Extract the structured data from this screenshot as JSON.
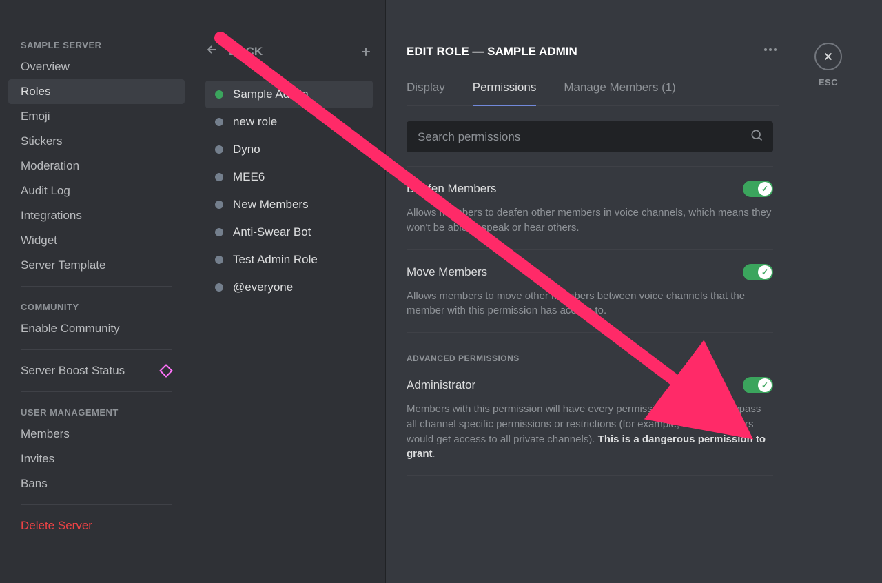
{
  "sidebar": {
    "server_name": "SAMPLE SERVER",
    "sections": {
      "main": [
        "Overview",
        "Roles",
        "Emoji",
        "Stickers",
        "Moderation",
        "Audit Log",
        "Integrations",
        "Widget",
        "Server Template"
      ],
      "community_header": "COMMUNITY",
      "community": [
        "Enable Community"
      ],
      "boost": "Server Boost Status",
      "user_header": "USER MANAGEMENT",
      "user": [
        "Members",
        "Invites",
        "Bans"
      ],
      "danger": "Delete Server"
    },
    "active_item": "Roles"
  },
  "rolecol": {
    "back_label": "BACK",
    "roles": [
      {
        "name": "Sample Admin",
        "color": "green",
        "selected": true
      },
      {
        "name": "new role",
        "color": "grey",
        "selected": false
      },
      {
        "name": "Dyno",
        "color": "grey",
        "selected": false
      },
      {
        "name": "MEE6",
        "color": "grey",
        "selected": false
      },
      {
        "name": "New Members",
        "color": "grey",
        "selected": false
      },
      {
        "name": "Anti-Swear Bot",
        "color": "grey",
        "selected": false
      },
      {
        "name": "Test Admin Role",
        "color": "grey",
        "selected": false
      },
      {
        "name": "@everyone",
        "color": "grey",
        "selected": false
      }
    ]
  },
  "main": {
    "title": "EDIT ROLE — SAMPLE ADMIN",
    "tabs": {
      "display": "Display",
      "permissions": "Permissions",
      "manage_members": "Manage Members (1)"
    },
    "active_tab": "permissions",
    "search_placeholder": "Search permissions",
    "sections": {
      "advanced_label": "ADVANCED PERMISSIONS"
    },
    "perms": {
      "deafen": {
        "title": "Deafen Members",
        "desc": "Allows members to deafen other members in voice channels, which means they won't be able to speak or hear others.",
        "on": true
      },
      "move": {
        "title": "Move Members",
        "desc": "Allows members to move other members between voice channels that the member with this permission has access to.",
        "on": true
      },
      "admin": {
        "title": "Administrator",
        "desc_pre": "Members with this permission will have every permission and will also bypass all channel specific permissions or restrictions (for example, these members would get access to all private channels). ",
        "desc_bold": "This is a dangerous permission to grant",
        "desc_post": ".",
        "on": true
      }
    }
  },
  "close": {
    "esc": "ESC"
  },
  "annotation": {
    "arrow_color": "#ff2a68"
  }
}
